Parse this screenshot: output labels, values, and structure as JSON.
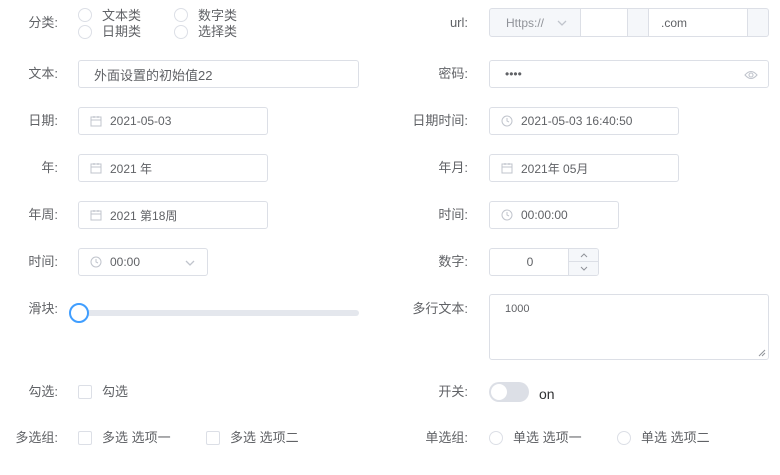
{
  "form": {
    "category": {
      "label": "分类:",
      "options": [
        "文本类",
        "数字类",
        "日期类",
        "选择类"
      ]
    },
    "url": {
      "label": "url:",
      "protocol": "Https://",
      "host": "",
      "suffix": ".com"
    },
    "text": {
      "label": "文本:",
      "value": "外面设置的初始值22"
    },
    "password": {
      "label": "密码:",
      "value": "••••"
    },
    "date": {
      "label": "日期:",
      "value": "2021-05-03"
    },
    "datetime": {
      "label": "日期时间:",
      "value": "2021-05-03 16:40:50"
    },
    "year": {
      "label": "年:",
      "value": "2021 年"
    },
    "month": {
      "label": "年月:",
      "value": "2021年 05月"
    },
    "week": {
      "label": "年周:",
      "value": "2021 第18周"
    },
    "time_right": {
      "label": "时间:",
      "value": "00:00:00"
    },
    "time_select": {
      "label": "时间:",
      "value": "00:00"
    },
    "number": {
      "label": "数字:",
      "value": "0"
    },
    "slider": {
      "label": "滑块:",
      "value": 0
    },
    "textarea": {
      "label": "多行文本:",
      "value": "1000"
    },
    "checkbox": {
      "label": "勾选:",
      "option": "勾选"
    },
    "switch": {
      "label": "开关:",
      "text": "on",
      "on": false
    },
    "checkbox_group": {
      "label": "多选组:",
      "options": [
        "多选 选项一",
        "多选 选项二"
      ]
    },
    "radio_group": {
      "label": "单选组:",
      "options": [
        "单选 选项一",
        "单选 选项二"
      ]
    }
  },
  "colors": {
    "border": "#dcdfe6",
    "text": "#606266",
    "placeholder": "#c0c4cc",
    "primary": "#409eff",
    "track": "#e4e7ed",
    "addon_bg": "#f5f7fa"
  },
  "icons": {
    "calendar": "calendar-icon",
    "clock": "clock-icon",
    "eye": "eye-icon",
    "chevron": "chevron-down-icon"
  }
}
